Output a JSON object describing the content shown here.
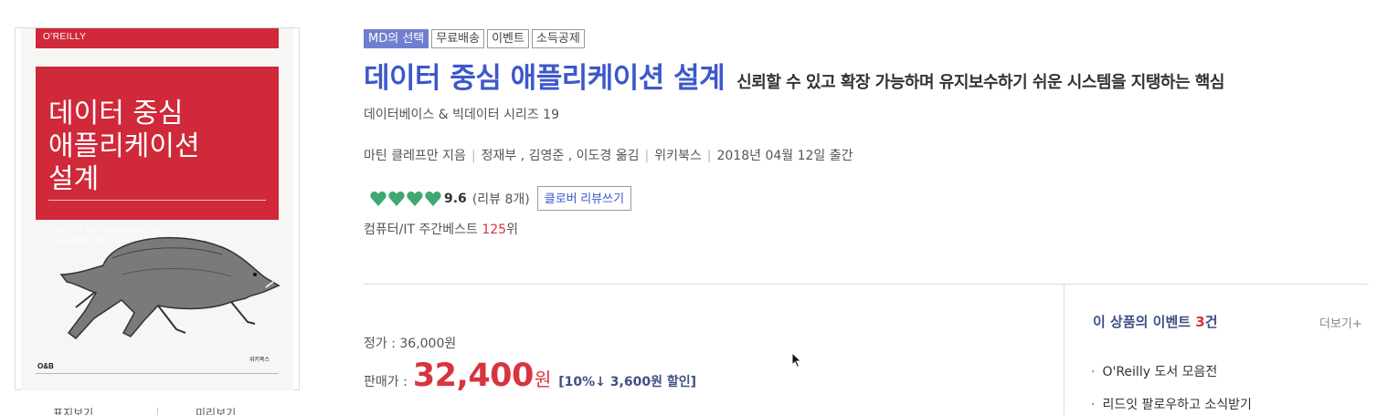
{
  "cover": {
    "brand": "O'REILLY",
    "title": "데이터 중심\n애플리케이션\n설계",
    "subtitle_lines": [
      "신뢰할 수 있고 확장 가능하며 유지보수하기 쉬운",
      "시스템을 지탱하는 핵심 아이디어"
    ],
    "publisher_logo": "O&B",
    "publisher_mark": "위키북스",
    "tab_left": "표지보기",
    "tab_right": "미리보기"
  },
  "badges": [
    "MD의 선택",
    "무료배송",
    "이벤트",
    "소득공제"
  ],
  "product": {
    "title": "데이터 중심 애플리케이션 설계",
    "subtitle": "신뢰할 수 있고 확장 가능하며 유지보수하기 쉬운 시스템을 지탱하는 핵심",
    "series": "데이터베이스 & 빅데이터 시리즈 19",
    "author": "마틴 클레프만 지음",
    "translators": "정재부 , 김영준 , 이도경 옮김",
    "publisher": "위키북스",
    "pub_date": "2018년 04월 12일 출간"
  },
  "rating": {
    "hearts": 4,
    "heart_color": "#3fa870",
    "score": "9.6",
    "review_count": "(리뷰 8개)",
    "review_button": "클로버 리뷰쓰기"
  },
  "bestseller": {
    "category": "컴퓨터/IT 주간베스트",
    "rank": "125",
    "suffix": "위"
  },
  "price": {
    "list_label": "정가 : 36,000원",
    "sale_label": "판매가 :",
    "sale_value": "32,400",
    "sale_unit": "원",
    "discount": "[10%↓ 3,600원 할인]"
  },
  "events": {
    "title_prefix": "이 상품의 이벤트",
    "count": "3",
    "title_suffix": "건",
    "more": "더보기+",
    "items": [
      "O'Reilly 도서 모음전",
      "리드잇 팔로우하고 소식받기"
    ]
  },
  "colors": {
    "title_blue": "#3c58c9",
    "price_red": "#d8343f",
    "cover_red": "#d0293a"
  }
}
